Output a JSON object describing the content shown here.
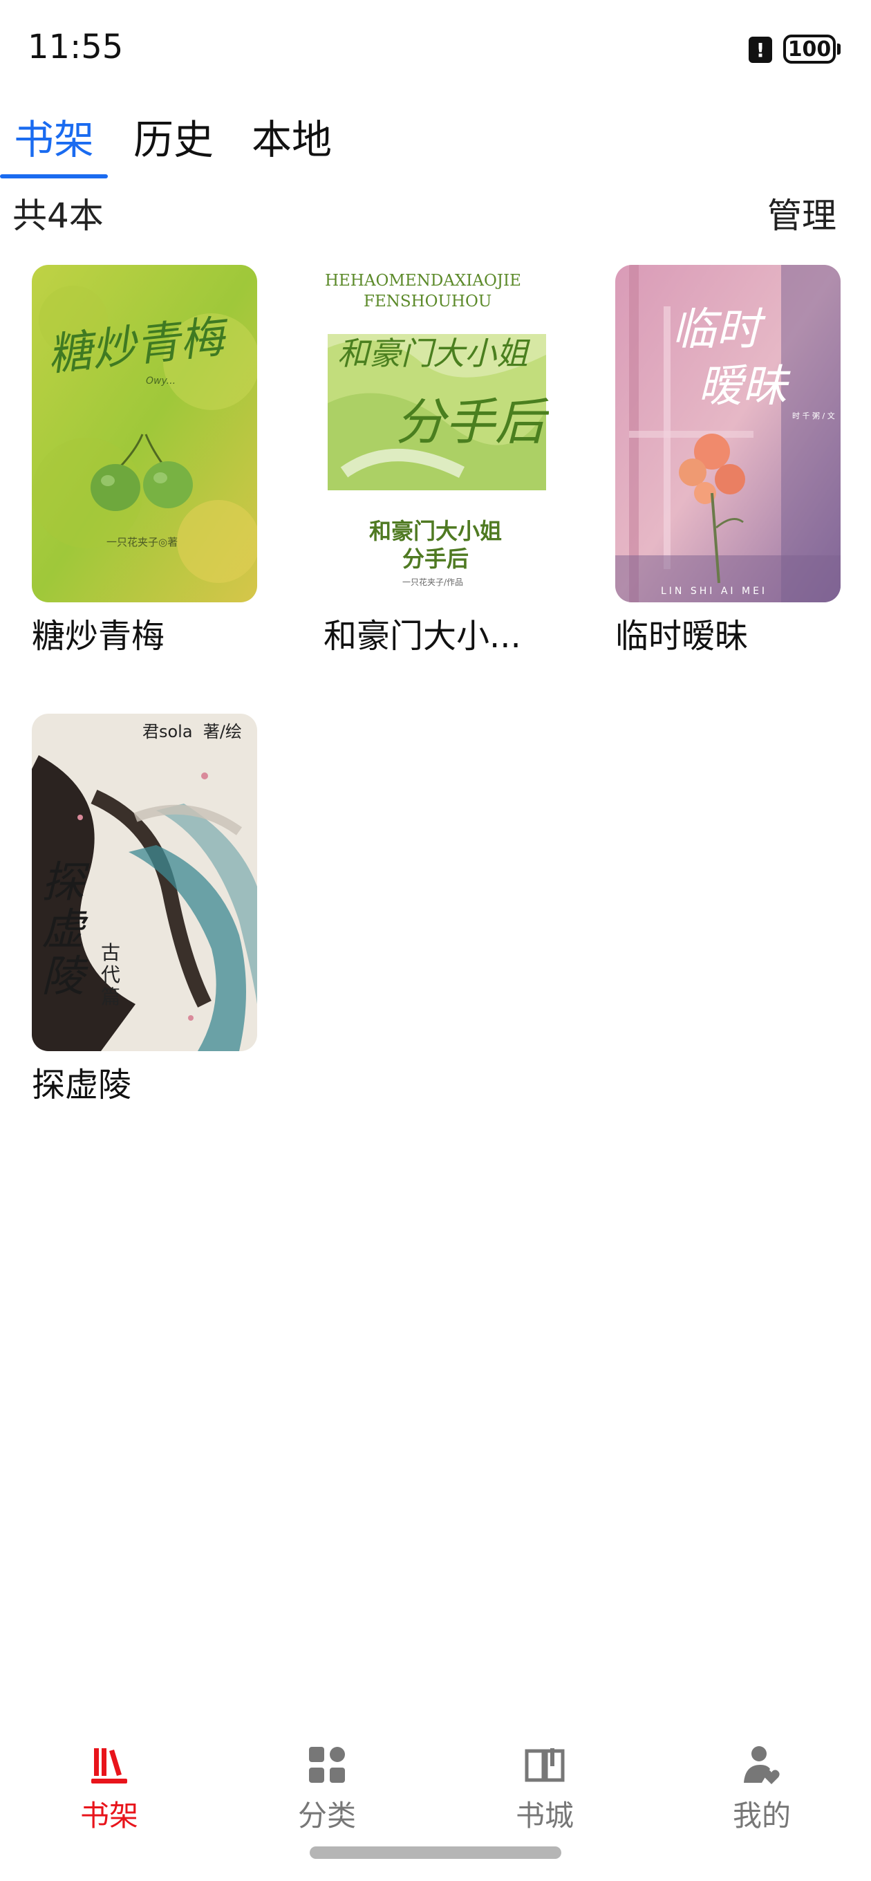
{
  "status_bar": {
    "time": "11:55",
    "alert": "!",
    "battery": "100"
  },
  "tabs": [
    {
      "label": "书架",
      "active": true
    },
    {
      "label": "历史",
      "active": false
    },
    {
      "label": "本地",
      "active": false
    }
  ],
  "shelf": {
    "count_label": "共4本",
    "manage_label": "管理",
    "books": [
      {
        "title": "糖炒青梅",
        "cover_title": "糖炒青梅",
        "cover_author": "一只花夹子◎著",
        "cover_signature": "Owy..."
      },
      {
        "title": "和豪门大小...",
        "cover_pinyin_1": "HEHAOMENDAXIAOJIE",
        "cover_pinyin_2": "FENSHOUHOU",
        "cover_brush_1": "和豪门大小姐",
        "cover_brush_2": "分手后",
        "cover_subtitle_1": "和豪门大小姐",
        "cover_subtitle_2": "分手后",
        "cover_author": "一只花夹子/作品"
      },
      {
        "title": "临时暧昧",
        "cover_title_1": "临时",
        "cover_title_2": "暧昧",
        "cover_author": "时 千 粥 / 文",
        "cover_pinyin": "LIN SHI AI MEI"
      },
      {
        "title": "探虚陵",
        "cover_author": "君sola  著/绘",
        "cover_title": "探虚陵",
        "cover_subtitle": "古代篇"
      }
    ]
  },
  "bottom_nav": [
    {
      "label": "书架",
      "icon": "bookshelf-icon",
      "active": true
    },
    {
      "label": "分类",
      "icon": "category-icon",
      "active": false
    },
    {
      "label": "书城",
      "icon": "open-book-icon",
      "active": false
    },
    {
      "label": "我的",
      "icon": "profile-icon",
      "active": false
    }
  ],
  "colors": {
    "tab_active": "#1a6bf0",
    "nav_active": "#e8141b",
    "nav_inactive": "#777777"
  }
}
